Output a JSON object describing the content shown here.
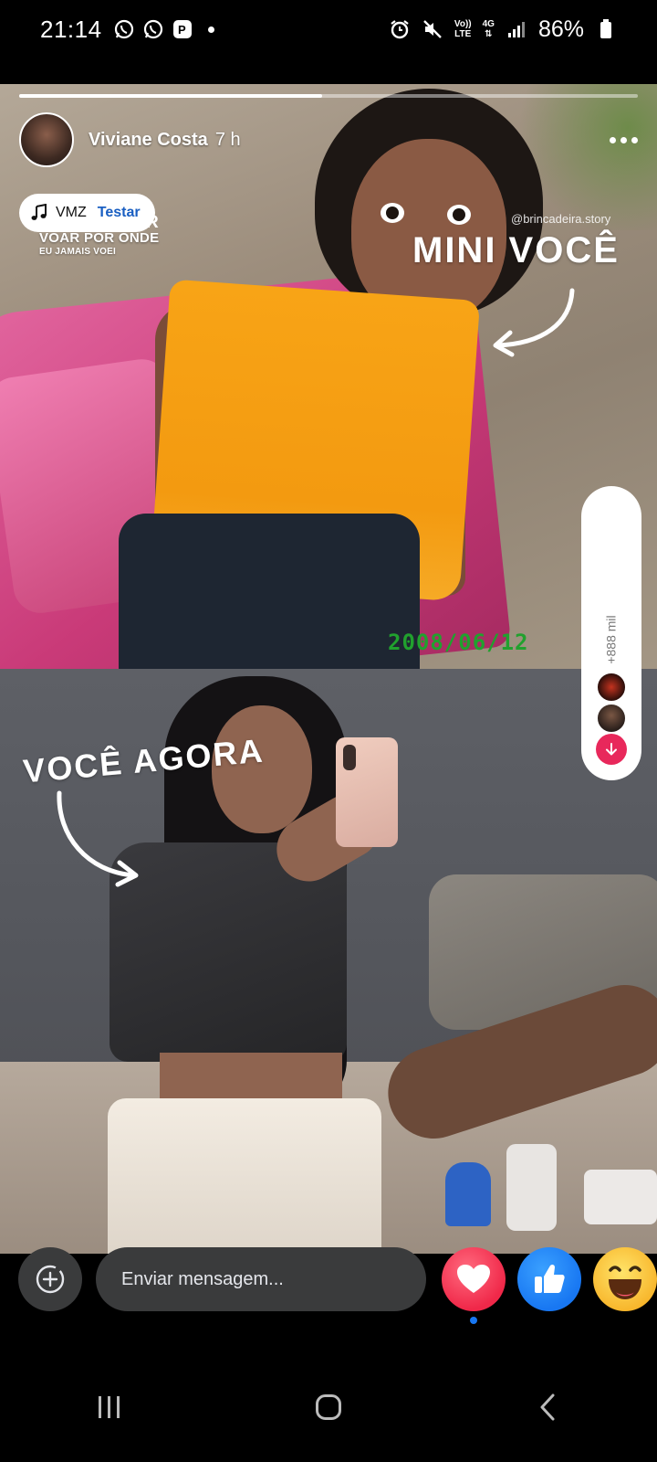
{
  "status_bar": {
    "time": "21:14",
    "battery": "86%",
    "network_top": "Vo))",
    "network_bottom": "LTE",
    "data_label": "4G"
  },
  "story": {
    "progress_fraction": 0.49,
    "author_name": "Viviane Costa",
    "time_ago": "7 h",
    "music": {
      "title": "VMZ",
      "try_label": "Testar"
    },
    "lyrics": {
      "ghost": "R",
      "line1": "VOAR POR ONDE",
      "line2": "EU JAMAIS VOEI"
    },
    "watermark": "@brincadeira.story",
    "caption_top": "MINI VOCÊ",
    "caption_bottom": "VOCÊ AGORA",
    "date_stamp": "2008/06/12"
  },
  "reactions": {
    "count_label": "+888 mil"
  },
  "footer": {
    "message_placeholder": "Enviar mensagem..."
  },
  "icons": {
    "add": "add-circle-icon",
    "love": "heart-icon",
    "like": "thumbs-up-icon",
    "haha": "laughing-face-icon",
    "music": "music-note-icon"
  },
  "colors": {
    "like_blue": "#1877f2",
    "love_red": "#f02849",
    "react_pink": "#e8285b"
  }
}
